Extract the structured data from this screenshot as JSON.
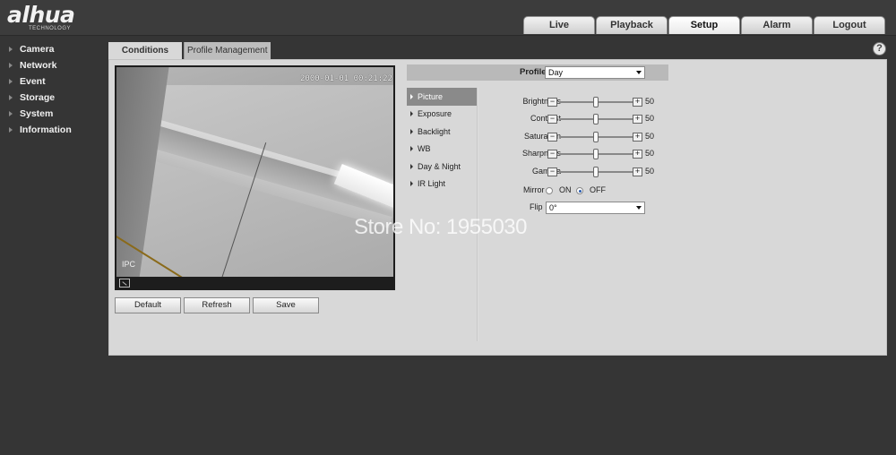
{
  "brand": {
    "logo": "alhua",
    "tagline": "TECHNOLOGY"
  },
  "topnav": {
    "tabs": [
      "Live",
      "Playback",
      "Setup",
      "Alarm",
      "Logout"
    ],
    "active": "Setup"
  },
  "sidebar": {
    "items": [
      "Camera",
      "Network",
      "Event",
      "Storage",
      "System",
      "Information"
    ]
  },
  "content_tabs": {
    "conditions": "Conditions",
    "profile_management": "Profile Management",
    "active": "Conditions"
  },
  "video": {
    "timestamp": "2000-01-01 00:21:22",
    "channel_name": "IPC"
  },
  "buttons": {
    "default": "Default",
    "refresh": "Refresh",
    "save": "Save"
  },
  "profile": {
    "label": "Profile",
    "value": "Day"
  },
  "subnav": {
    "items": [
      "Picture",
      "Exposure",
      "Backlight",
      "WB",
      "Day & Night",
      "IR Light"
    ],
    "active": "Picture"
  },
  "picture": {
    "sliders": [
      {
        "label": "Brightness",
        "value": "50"
      },
      {
        "label": "Contrast",
        "value": "50"
      },
      {
        "label": "Saturation",
        "value": "50"
      },
      {
        "label": "Sharpness",
        "value": "50"
      },
      {
        "label": "Gamma",
        "value": "50"
      }
    ],
    "slider_button_minus": "−",
    "slider_button_plus": "+",
    "mirror": {
      "label": "Mirror",
      "on": "ON",
      "off": "OFF",
      "selected": "OFF"
    },
    "flip": {
      "label": "Flip",
      "value": "0°"
    }
  },
  "help": {
    "icon": "?"
  },
  "watermark": "Store No: 1955030"
}
